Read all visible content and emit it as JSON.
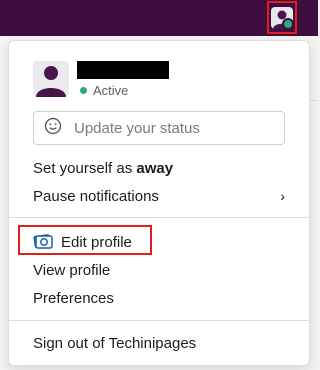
{
  "menu": {
    "presence": "Active",
    "status_placeholder": "Update your status",
    "set_away_prefix": "Set yourself as ",
    "set_away_bold": "away",
    "pause_notifications": "Pause notifications",
    "edit_profile": "Edit profile",
    "view_profile": "View profile",
    "preferences": "Preferences",
    "sign_out": "Sign out of Techinipages"
  },
  "colors": {
    "topbar": "#3f0e40",
    "avatar_purple": "#4a154b",
    "presence_green": "#2bac76",
    "highlight_red": "#e01e1e"
  }
}
